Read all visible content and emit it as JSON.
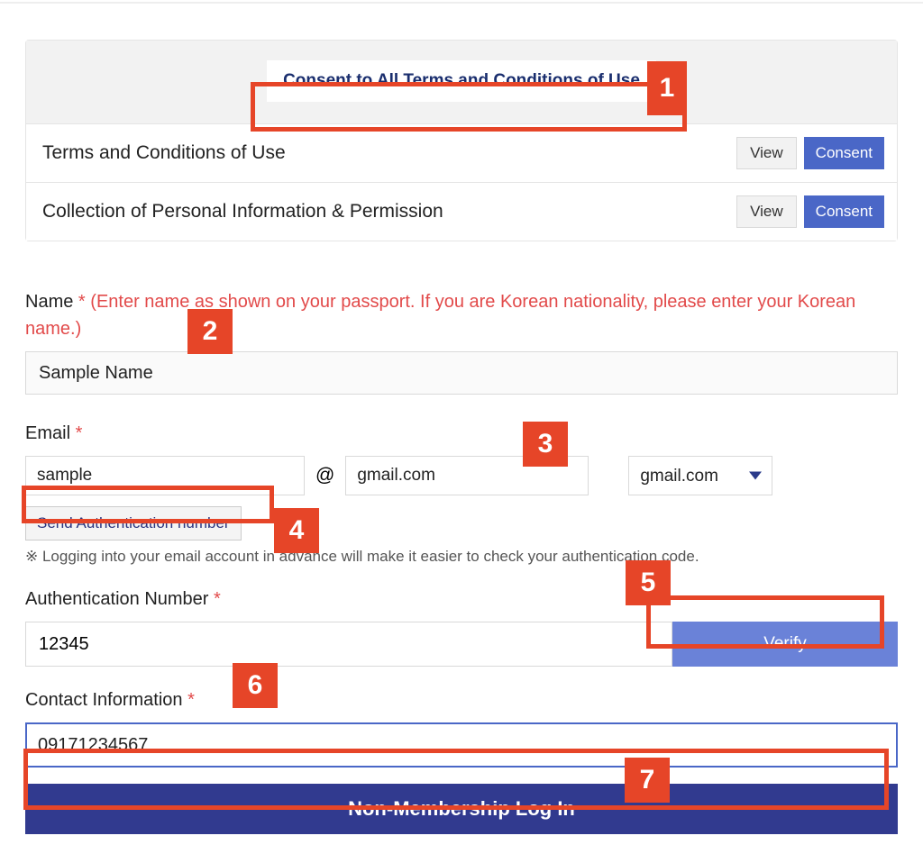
{
  "terms": {
    "header": "Consent to All Terms and Conditions of Use",
    "rows": [
      {
        "label": "Terms and Conditions of Use",
        "view": "View",
        "consent": "Consent"
      },
      {
        "label": "Collection of Personal Information & Permission",
        "view": "View",
        "consent": "Consent"
      }
    ]
  },
  "name": {
    "label": "Name",
    "hint": "(Enter name as shown on your passport. If you are Korean nationality, please enter your Korean name.)",
    "value": "Sample Name"
  },
  "email": {
    "label": "Email",
    "local": "sample",
    "at": "@",
    "domain": "gmail.com",
    "select": "gmail.com",
    "send_btn": "Send Authentication number",
    "tip": "※ Logging into your email account in advance will make it easier to check your authentication code."
  },
  "auth": {
    "label": "Authentication Number",
    "value": "12345",
    "verify": "Verify"
  },
  "contact": {
    "label": "Contact Information",
    "value": "09171234567"
  },
  "login_btn": "Non-Membership Log In",
  "markers": {
    "1": "1",
    "2": "2",
    "3": "3",
    "4": "4",
    "5": "5",
    "6": "6",
    "7": "7"
  },
  "colors": {
    "accent_red": "#e64528",
    "accent_blue": "#4a67c7",
    "dark_blue": "#313a8f"
  }
}
